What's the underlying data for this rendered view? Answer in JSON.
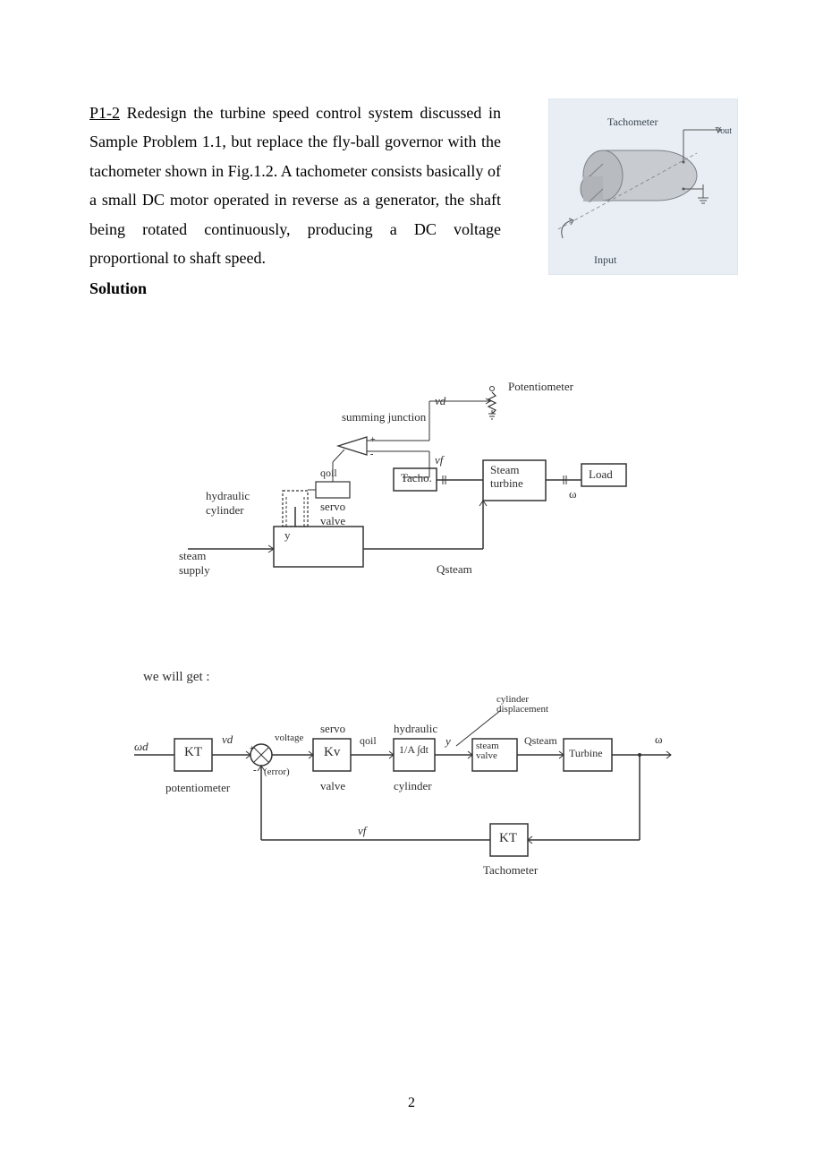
{
  "problem": {
    "ref": "P1-2",
    "text": " Redesign the turbine speed control system discussed in Sample Problem 1.1, but replace the fly-ball governor with the tachometer shown in Fig.1.2. A tachometer consists basically of a small DC motor operated in reverse as a generator, the shaft being rotated continuously, producing a DC voltage proportional to shaft speed."
  },
  "solution_heading": "Solution",
  "tacho_fig": {
    "label_top": "Tachometer",
    "label_output": "Vout",
    "label_input": "Input"
  },
  "schematic": {
    "summing_junction": "summing junction",
    "potentiometer": "Potentiometer",
    "vd": "vd",
    "vf": "vf",
    "hydraulic_cylinder": "hydraulic cylinder",
    "servo_valve": "servo valve",
    "qoil": "qoil",
    "y": "y",
    "steam_supply": "steam supply",
    "tacho": "Tacho.",
    "steam_turbine": "Steam turbine",
    "load": "Load",
    "omega": "ω",
    "qsteam": "Qsteam"
  },
  "block_diagram": {
    "intro": "we will get :",
    "wd": "ωd",
    "kt1": "KT",
    "potentiometer": "potentiometer",
    "vd": "vd",
    "voltage": "voltage",
    "error": "(error)",
    "kv": "Kv",
    "servo": "servo",
    "valve": "valve",
    "qoil": "qoil",
    "integral": "1/A ∫dt",
    "hydraulic": "hydraulic",
    "cylinder": "cylinder",
    "y": "y",
    "steam_valve": "steam valve",
    "cylinder_displacement": "cylinder displacement",
    "qsteam": "Qsteam",
    "turbine": "Turbine",
    "omega": "ω",
    "kt2": "KT",
    "tachometer": "Tachometer",
    "vf": "vf"
  },
  "page_number": "2"
}
